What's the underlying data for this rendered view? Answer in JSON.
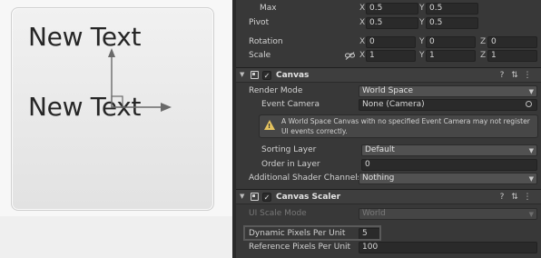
{
  "scene": {
    "text_top": "New Text",
    "text_bottom": "New Text",
    "colors": {
      "gizmo": "#666666",
      "panel": "#e8e8e8"
    }
  },
  "transform": {
    "max": {
      "label": "Max",
      "x_axis": "X",
      "x": "0.5",
      "y_axis": "Y",
      "y": "0.5"
    },
    "pivot": {
      "label": "Pivot",
      "x_axis": "X",
      "x": "0.5",
      "y_axis": "Y",
      "y": "0.5"
    },
    "rotation": {
      "label": "Rotation",
      "x_axis": "X",
      "x": "0",
      "y_axis": "Y",
      "y": "0",
      "z_axis": "Z",
      "z": "0"
    },
    "scale": {
      "label": "Scale",
      "x_axis": "X",
      "x": "1",
      "y_axis": "Y",
      "y": "1",
      "z_axis": "Z",
      "z": "1",
      "link_icon": "link-icon"
    }
  },
  "canvas": {
    "title": "Canvas",
    "checked": "✓",
    "header_icons": [
      "?",
      "⇅",
      "⋮"
    ],
    "render_mode": {
      "label": "Render Mode",
      "value": "World Space"
    },
    "event_camera": {
      "label": "Event Camera",
      "value": "None (Camera)"
    },
    "warning": "A World Space Canvas with no specified Event Camera may not register UI events correctly.",
    "sorting_layer": {
      "label": "Sorting Layer",
      "value": "Default"
    },
    "order_in_layer": {
      "label": "Order in Layer",
      "value": "0"
    },
    "shader_channels": {
      "label": "Additional Shader Channels",
      "value": "Nothing"
    }
  },
  "canvas_scaler": {
    "title": "Canvas Scaler",
    "checked": "✓",
    "header_icons": [
      "?",
      "⇅",
      "⋮"
    ],
    "ui_scale_mode": {
      "label": "UI Scale Mode",
      "value": "World"
    },
    "dynamic_pixels": {
      "label": "Dynamic Pixels Per Unit",
      "value": "5"
    },
    "reference_pixels": {
      "label": "Reference Pixels Per Unit",
      "value": "100"
    }
  }
}
